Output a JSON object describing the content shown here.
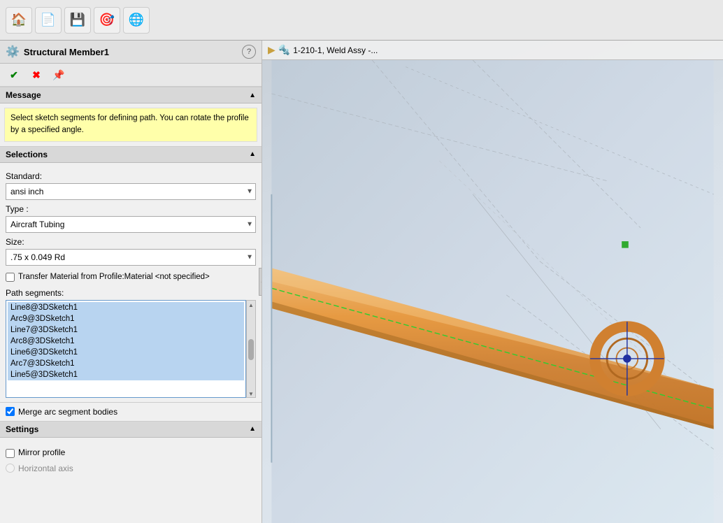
{
  "toolbar": {
    "buttons": [
      {
        "name": "home-button",
        "icon": "🏠"
      },
      {
        "name": "document-button",
        "icon": "📄"
      },
      {
        "name": "save-button",
        "icon": "💾"
      },
      {
        "name": "target-button",
        "icon": "🎯"
      },
      {
        "name": "sphere-button",
        "icon": "🌐"
      }
    ]
  },
  "panel": {
    "title": "Structural Member1",
    "help_label": "?",
    "actions": {
      "confirm_icon": "✔",
      "cancel_icon": "✖",
      "pin_icon": "📌"
    }
  },
  "message": {
    "section_label": "Message",
    "content": "Select sketch segments for defining path. You can rotate the profile by a specified angle."
  },
  "selections": {
    "section_label": "Selections",
    "standard_label": "Standard:",
    "standard_value": "ansi inch",
    "type_label": "Type :",
    "type_value": "Aircraft Tubing",
    "size_label": "Size:",
    "size_value": ".75 x 0.049 Rd",
    "transfer_material_label": "Transfer Material from Profile:Material  <not specified>",
    "path_segments_label": "Path segments:",
    "path_items": [
      "Line8@3DSketch1",
      "Arc9@3DSketch1",
      "Line7@3DSketch1",
      "Arc8@3DSketch1",
      "Line6@3DSketch1",
      "Arc7@3DSketch1",
      "Line5@3DSketch1"
    ]
  },
  "merge": {
    "label": "Merge arc segment bodies",
    "checked": true
  },
  "settings": {
    "section_label": "Settings",
    "mirror_profile_label": "Mirror profile",
    "horizontal_axis_label": "Horizontal axis"
  },
  "breadcrumb": {
    "icon": "🔧",
    "text": "1-210-1, Weld Assy -..."
  }
}
